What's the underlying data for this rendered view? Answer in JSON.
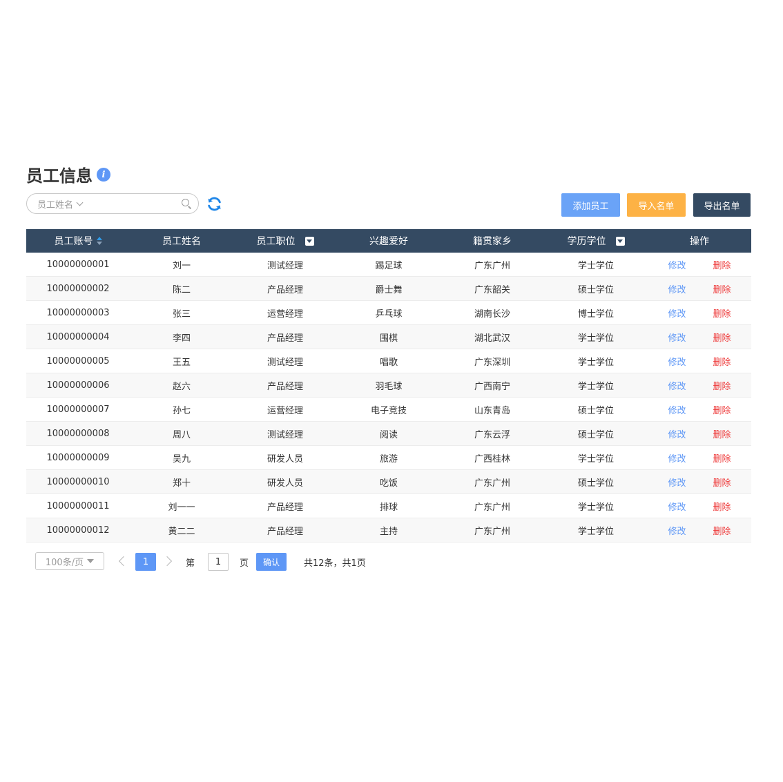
{
  "header": {
    "title": "员工信息",
    "info_icon_glyph": "i"
  },
  "search": {
    "field_label": "员工姓名",
    "icon": "search-icon"
  },
  "toolbar": {
    "add_label": "添加员工",
    "import_label": "导入名单",
    "export_label": "导出名单"
  },
  "colors": {
    "header_bg": "#344a62",
    "primary": "#5e97f6",
    "warning": "#fdb245",
    "danger": "#ee3a3a"
  },
  "table": {
    "columns": [
      "员工账号",
      "员工姓名",
      "员工职位",
      "兴趣爱好",
      "籍贯家乡",
      "学历学位",
      "操作"
    ],
    "edit_label": "修改",
    "delete_label": "删除",
    "rows": [
      [
        "10000000001",
        "刘一",
        "测试经理",
        "踢足球",
        "广东广州",
        "学士学位"
      ],
      [
        "10000000002",
        "陈二",
        "产品经理",
        "爵士舞",
        "广东韶关",
        "硕士学位"
      ],
      [
        "10000000003",
        "张三",
        "运营经理",
        "乒乓球",
        "湖南长沙",
        "博士学位"
      ],
      [
        "10000000004",
        "李四",
        "产品经理",
        "围棋",
        "湖北武汉",
        "学士学位"
      ],
      [
        "10000000005",
        "王五",
        "测试经理",
        "唱歌",
        "广东深圳",
        "学士学位"
      ],
      [
        "10000000006",
        "赵六",
        "产品经理",
        "羽毛球",
        "广西南宁",
        "学士学位"
      ],
      [
        "10000000007",
        "孙七",
        "运营经理",
        "电子竞技",
        "山东青岛",
        "硕士学位"
      ],
      [
        "10000000008",
        "周八",
        "测试经理",
        "阅读",
        "广东云浮",
        "硕士学位"
      ],
      [
        "10000000009",
        "吴九",
        "研发人员",
        "旅游",
        "广西桂林",
        "学士学位"
      ],
      [
        "10000000010",
        "郑十",
        "研发人员",
        "吃饭",
        "广东广州",
        "硕士学位"
      ],
      [
        "10000000011",
        "刘一一",
        "产品经理",
        "排球",
        "广东广州",
        "学士学位"
      ],
      [
        "10000000012",
        "黄二二",
        "产品经理",
        "主持",
        "广东广州",
        "学士学位"
      ]
    ]
  },
  "pagination": {
    "page_size": "100条/页",
    "current_page": "1",
    "goto_prefix": "第",
    "goto_value": "1",
    "goto_suffix": "页",
    "confirm_label": "确认",
    "total_text": "共12条，共1页"
  }
}
